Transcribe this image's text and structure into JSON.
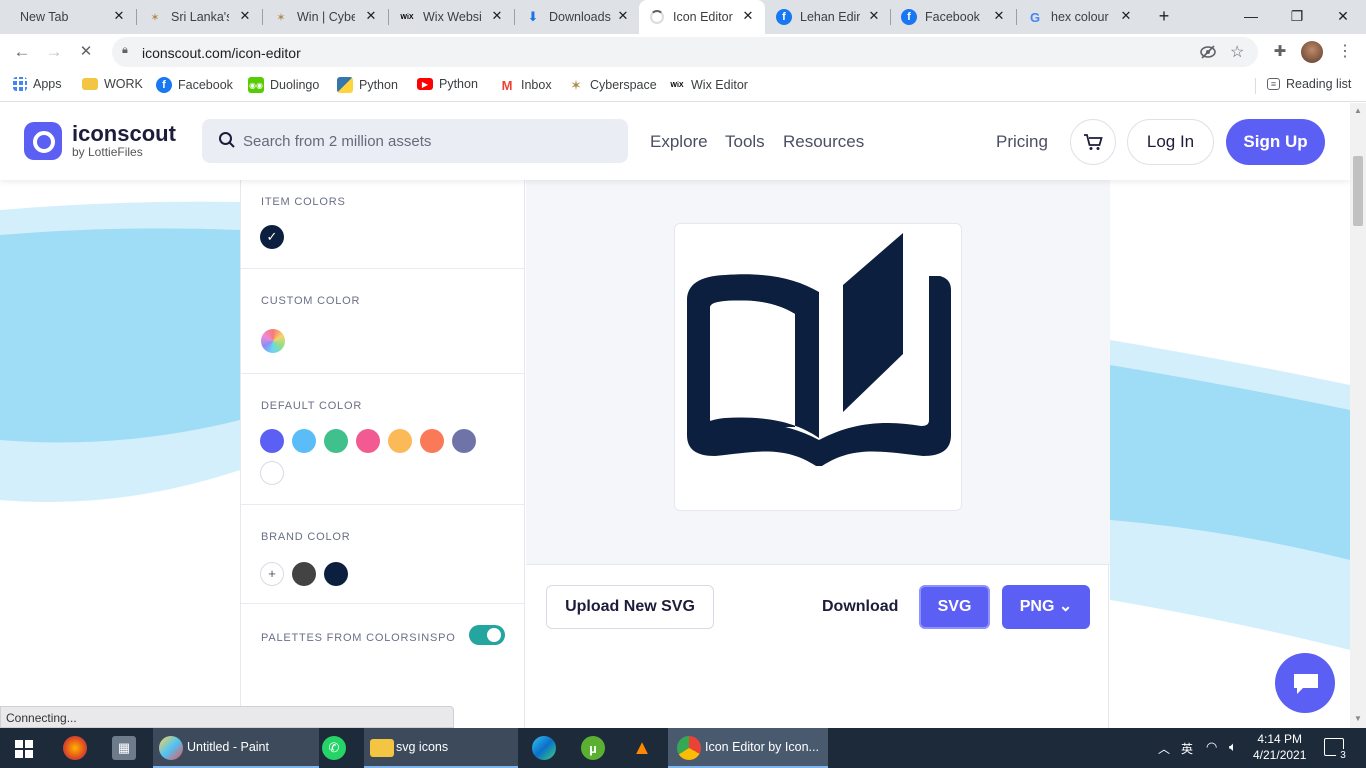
{
  "browser": {
    "tabs": [
      {
        "label": "New Tab",
        "icon": "none",
        "close": "✕"
      },
      {
        "label": "Sri Lanka's",
        "icon": "star-icon",
        "close": "✕"
      },
      {
        "label": "Win | Cyber",
        "icon": "star-icon",
        "close": "✕"
      },
      {
        "label": "Wix Websit",
        "icon": "wix-icon",
        "close": "✕"
      },
      {
        "label": "Downloads",
        "icon": "download-icon",
        "close": "✕"
      },
      {
        "label": "Icon Editor",
        "icon": "loading-icon",
        "close": "✕"
      },
      {
        "label": "Lehan Ediris",
        "icon": "facebook-icon",
        "close": "✕"
      },
      {
        "label": "Facebook",
        "icon": "facebook-icon",
        "close": "✕"
      },
      {
        "label": "hex colour",
        "icon": "google-icon",
        "close": "✕"
      }
    ],
    "new_tab": "+",
    "window": {
      "minimize": "—",
      "restore": "❐",
      "close": "✕"
    },
    "url": "iconscout.com/icon-editor",
    "bookmarks": [
      {
        "label": "Apps",
        "icon": "apps-grid-icon"
      },
      {
        "label": "WORK",
        "icon": "folder-icon"
      },
      {
        "label": "Facebook",
        "icon": "facebook-icon"
      },
      {
        "label": "Duolingo",
        "icon": "duolingo-icon"
      },
      {
        "label": "Python",
        "icon": "python-icon"
      },
      {
        "label": "Python",
        "icon": "youtube-icon"
      },
      {
        "label": "Inbox",
        "icon": "gmail-icon"
      },
      {
        "label": "Cyberspace",
        "icon": "star-icon"
      },
      {
        "label": "Wix Editor",
        "icon": "wix-icon"
      }
    ],
    "reading_list": "Reading list",
    "status": "Connecting..."
  },
  "site": {
    "logo_name": "iconscout",
    "logo_sub": "by LottieFiles",
    "search_placeholder": "Search from 2 million assets",
    "nav": [
      "Explore",
      "Tools",
      "Resources"
    ],
    "pricing": "Pricing",
    "login": "Log In",
    "signup": "Sign Up"
  },
  "editor": {
    "item_colors_title": "ITEM COLORS",
    "item_colors": [
      "#0c1f3f"
    ],
    "custom_color_title": "CUSTOM COLOR",
    "default_color_title": "DEFAULT COLOR",
    "default_colors": [
      "#5c5ff3",
      "#5bbdf8",
      "#3fc08c",
      "#f25b92",
      "#fbb957",
      "#fa7958",
      "#6e74a8",
      "#ffffff"
    ],
    "brand_color_title": "BRAND COLOR",
    "brand_colors": [
      "#434343",
      "#0c1f3f"
    ],
    "palettes_title": "PALETTES FROM COLORSINSPO",
    "palettes_toggle": true,
    "upload_label": "Upload New SVG",
    "download_label": "Download",
    "svg_label": "SVG",
    "png_label": "PNG ⌄",
    "icon_color": "#0c1f3f"
  },
  "taskbar": {
    "items": [
      {
        "label": "Untitled - Paint",
        "icon": "paint-icon"
      },
      {
        "label": "svg icons",
        "icon": "folder-icon"
      },
      {
        "label": "Icon Editor by Icon...",
        "icon": "chrome-icon"
      }
    ],
    "tray_lang": "英",
    "time": "4:14 PM",
    "date": "4/21/2021",
    "notifications": "3"
  },
  "colors": {
    "accent": "#5c5ff3",
    "dark_navy": "#0c1f3f",
    "teal": "#25a5a0"
  }
}
